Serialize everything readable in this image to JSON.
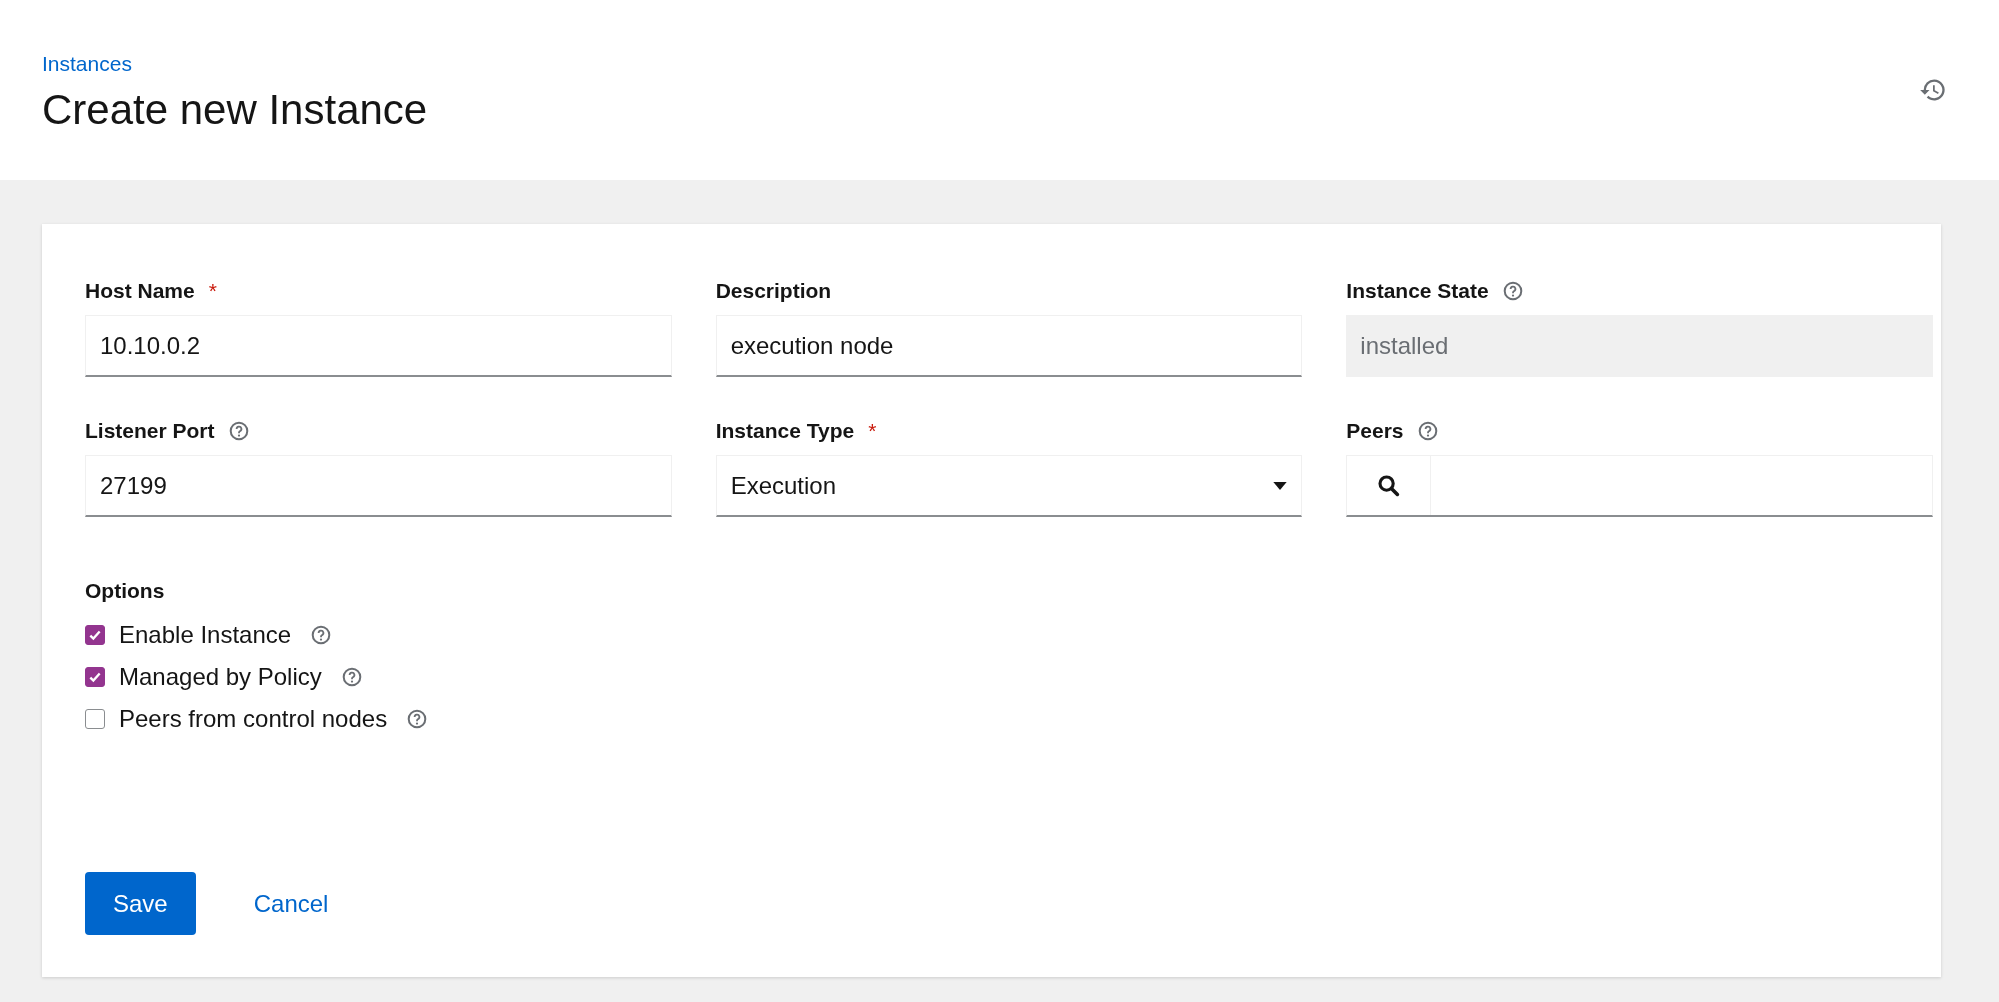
{
  "breadcrumb": "Instances",
  "title": "Create new Instance",
  "fields": [
    {
      "kind": "text",
      "label": "Host Name",
      "required_mark": "*",
      "help": false,
      "value": "10.10.0.2"
    },
    {
      "kind": "text",
      "label": "Description",
      "help": false,
      "value": "execution node"
    },
    {
      "kind": "readonly",
      "label": "Instance State",
      "help": true,
      "value": "installed"
    },
    {
      "kind": "text",
      "label": "Listener Port",
      "help": true,
      "value": "27199"
    },
    {
      "kind": "select",
      "label": "Instance Type",
      "required_mark": "*",
      "help": false,
      "value": "Execution"
    },
    {
      "kind": "search",
      "label": "Peers",
      "help": true
    }
  ],
  "options": {
    "label": "Options",
    "items": [
      {
        "label": "Enable Instance",
        "checked": true
      },
      {
        "label": "Managed by Policy",
        "checked": true
      },
      {
        "label": "Peers from control nodes",
        "checked": false
      }
    ]
  },
  "buttons": {
    "save": "Save",
    "cancel": "Cancel"
  }
}
